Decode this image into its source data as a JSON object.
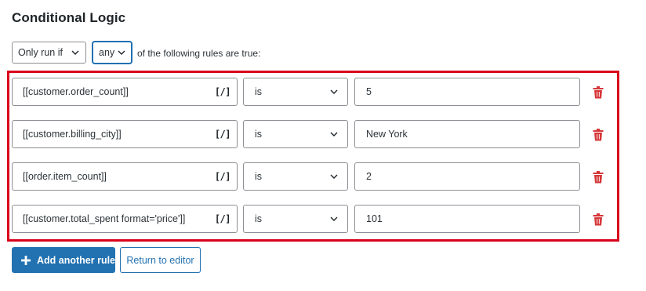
{
  "heading": "Conditional Logic",
  "condition": {
    "mode_select": "Only run if",
    "match_select": "any",
    "suffix_text": "of the following rules are true:"
  },
  "rules": [
    {
      "field": "[[customer.order_count]]",
      "merge_tag": "[/]",
      "operator": "is",
      "value": "5"
    },
    {
      "field": "[[customer.billing_city]]",
      "merge_tag": "[/]",
      "operator": "is",
      "value": "New York"
    },
    {
      "field": "[[order.item_count]]",
      "merge_tag": "[/]",
      "operator": "is",
      "value": "2"
    },
    {
      "field": "[[customer.total_spent format='price']]",
      "merge_tag": "[/]",
      "operator": "is",
      "value": "101"
    }
  ],
  "actions": {
    "add_rule_label": "Add another rule",
    "return_label": "Return to editor"
  },
  "colors": {
    "accent": "#2271b1",
    "highlight_frame": "#d9001b",
    "trash": "#d63638"
  },
  "icons": {
    "dropdown": "chevron-down-icon",
    "delete": "trash-icon",
    "add": "plus-icon"
  }
}
